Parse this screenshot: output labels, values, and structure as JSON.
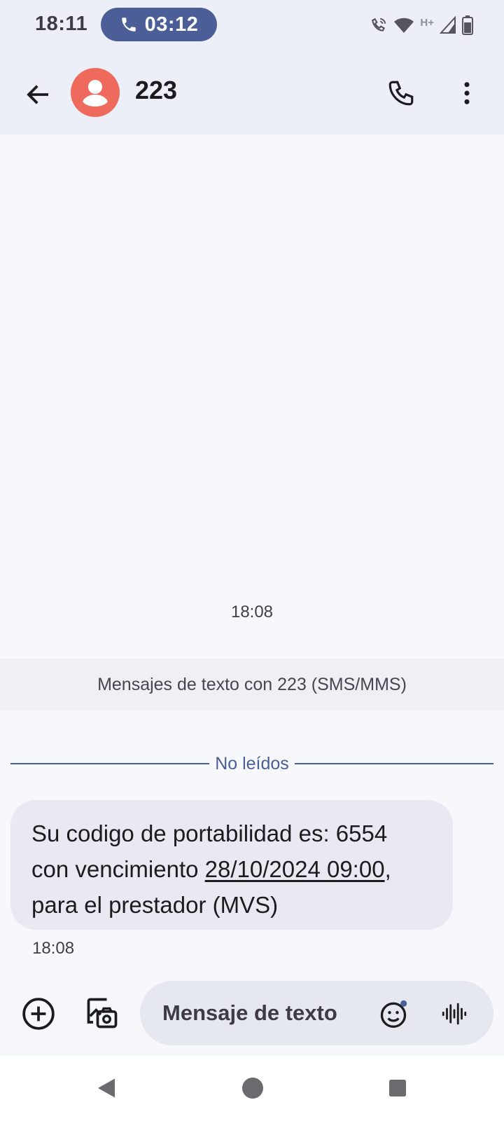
{
  "status_bar": {
    "time": "18:11",
    "call_timer": "03:12",
    "network_type": "H+",
    "icons": [
      "wifi-calling-icon",
      "wifi-icon",
      "cell-signal-icon",
      "battery-icon"
    ]
  },
  "header": {
    "contact_name": "223",
    "avatar_color": "#ee6a5c",
    "icons": [
      "back-arrow-icon",
      "phone-icon",
      "more-vert-icon"
    ]
  },
  "conversation": {
    "timestamp": "18:08",
    "banner": "Mensajes de texto con 223 (SMS/MMS)",
    "unread_divider": "No leídos",
    "messages": [
      {
        "line1": "Su codigo de portabilidad es: 6554",
        "line2_prefix": "con vencimiento ",
        "line2_link": "28/10/2024 09:00",
        "line2_suffix": ",",
        "line3": "para el prestador (MVS)",
        "time": "18:08"
      }
    ]
  },
  "composer": {
    "placeholder": "Mensaje de texto",
    "icons": [
      "add-circle-icon",
      "gallery-icon",
      "emoji-icon",
      "voice-icon"
    ]
  },
  "nav": {
    "icons": [
      "nav-back-icon",
      "nav-home-icon",
      "nav-recents-icon"
    ]
  },
  "colors": {
    "accent": "#4b5e98",
    "header_bg": "#eceff7",
    "page_bg": "#f7f8fc",
    "bubble_bg": "#e8e9f1"
  }
}
